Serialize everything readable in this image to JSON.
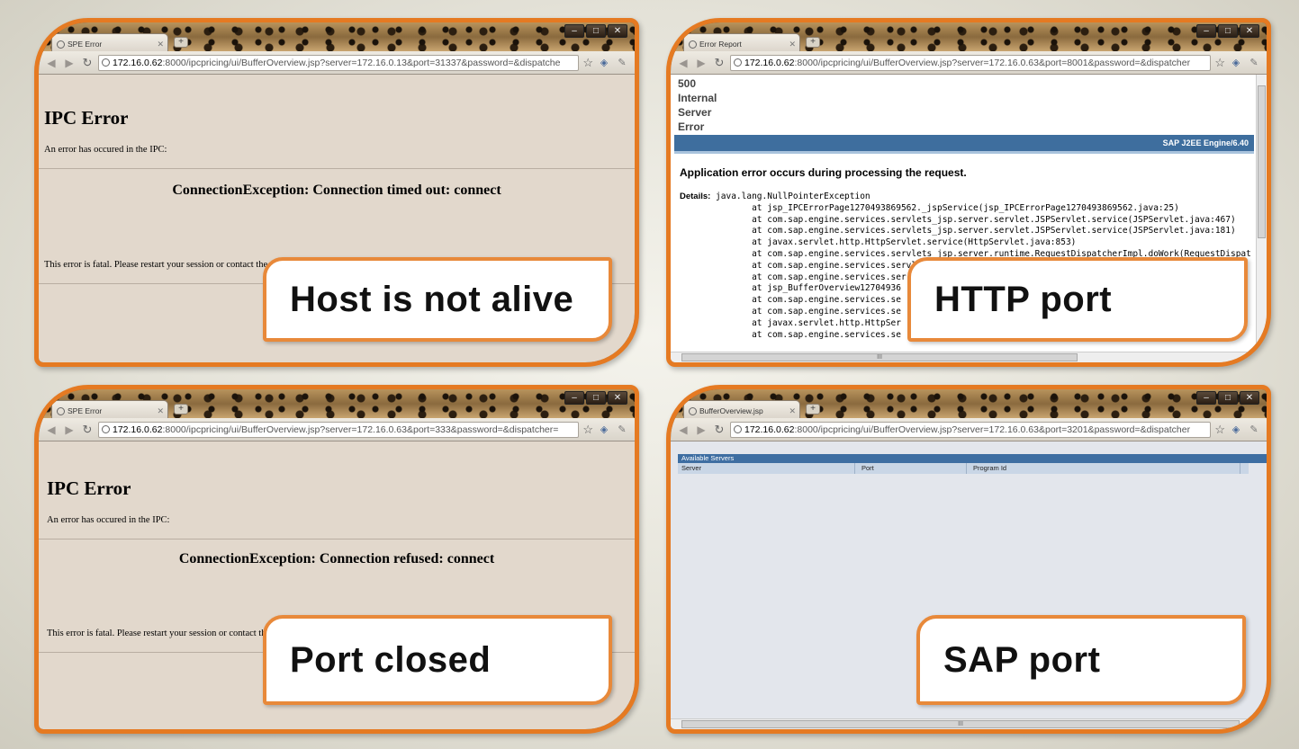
{
  "panels": {
    "p1": {
      "tab_title": "SPE Error",
      "url_host": "172.16.0.62",
      "url_rest": ":8000/ipcpricing/ui/BufferOverview.jsp?server=172.16.0.13&port=31337&password=&dispatche",
      "heading": "IPC Error",
      "message": "An error has occured in the IPC:",
      "exception": "ConnectionException: Connection timed out: connect",
      "fatal": "This error is fatal. Please restart your session or contact the sy",
      "callout": "Host is not alive"
    },
    "p2": {
      "tab_title": "Error Report",
      "url_host": "172.16.0.62",
      "url_rest": ":8000/ipcpricing/ui/BufferOverview.jsp?server=172.16.0.63&port=8001&password=&dispatcher",
      "status": "500\nInternal\nServer\nError",
      "engine": "SAP J2EE Engine/6.40",
      "app_error": "Application error occurs during processing the request.",
      "details_label": "Details:",
      "details_text": " java.lang.NullPointerException\n              at jsp_IPCErrorPage1270493869562._jspService(jsp_IPCErrorPage1270493869562.java:25)\n              at com.sap.engine.services.servlets_jsp.server.servlet.JSPServlet.service(JSPServlet.java:467)\n              at com.sap.engine.services.servlets_jsp.server.servlet.JSPServlet.service(JSPServlet.java:181)\n              at javax.servlet.http.HttpServlet.service(HttpServlet.java:853)\n              at com.sap.engine.services.servlets_jsp.server.runtime.RequestDispatcherImpl.doWork(RequestDispat\n              at com.sap.engine.services.servl\n              at com.sap.engine.services.ser\n              at jsp_BufferOverview12704936\n              at com.sap.engine.services.se\n              at com.sap.engine.services.se\n              at javax.servlet.http.HttpSer\n              at com.sap.engine.services.se",
      "scroll_mark": "III",
      "callout": "HTTP port"
    },
    "p3": {
      "tab_title": "SPE Error",
      "url_host": "172.16.0.62",
      "url_rest": ":8000/ipcpricing/ui/BufferOverview.jsp?server=172.16.0.63&port=333&password=&dispatcher=",
      "heading": "IPC Error",
      "message": "An error has occured in the IPC:",
      "exception": "ConnectionException: Connection refused: connect",
      "fatal": "This error is fatal. Please restart your session or contact th",
      "callout": "Port closed"
    },
    "p4": {
      "tab_title": "BufferOverview.jsp",
      "url_host": "172.16.0.62",
      "url_rest": ":8000/ipcpricing/ui/BufferOverview.jsp?server=172.16.0.63&port=3201&password=&dispatcher",
      "table_title": "Available Servers",
      "columns": [
        "Server",
        "Port",
        "Program Id"
      ],
      "scroll_mark": "III",
      "callout": "SAP port"
    }
  },
  "icons": {
    "back": "arrow-left-icon",
    "forward": "arrow-right-icon",
    "reload": "reload-icon",
    "star": "star-icon",
    "wrench": "wrench-icon"
  },
  "colors": {
    "callout_border": "#e8893a",
    "sap_bar": "#3e6e9e",
    "ipc_background": "#e2d8cc"
  }
}
